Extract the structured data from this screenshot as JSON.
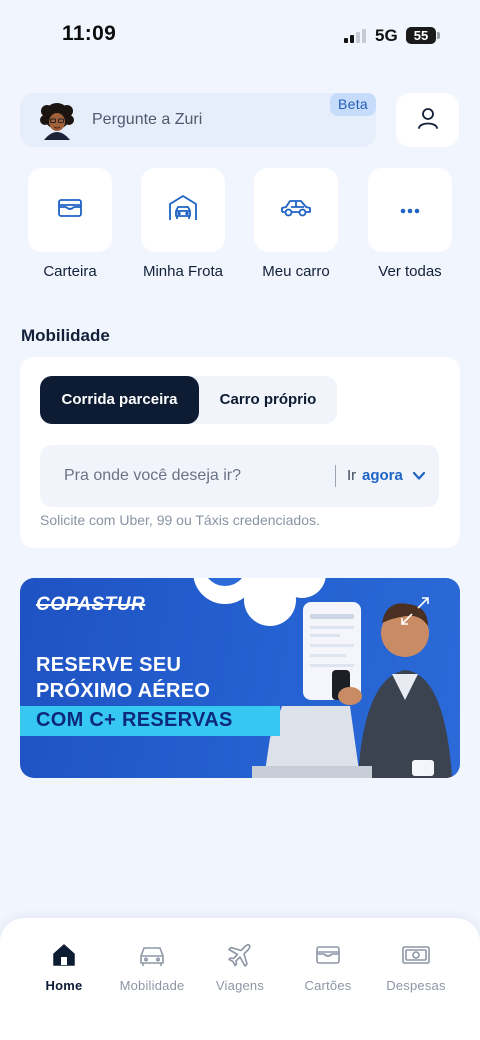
{
  "status_bar": {
    "time": "11:09",
    "network": "5G",
    "battery": "55"
  },
  "assistant": {
    "placeholder": "Pergunte a Zuri",
    "badge": "Beta",
    "avatar_icon": "zuri-avatar-icon"
  },
  "profile": {
    "icon": "user-icon"
  },
  "shortcuts": [
    {
      "label": "Carteira",
      "icon": "wallet-icon"
    },
    {
      "label": "Minha Frota",
      "icon": "garage-icon"
    },
    {
      "label": "Meu carro",
      "icon": "car-icon"
    },
    {
      "label": "Ver todas",
      "icon": "more-icon"
    }
  ],
  "mobility": {
    "title": "Mobilidade",
    "tabs": [
      {
        "label": "Corrida parceira",
        "active": true
      },
      {
        "label": "Carro próprio",
        "active": false
      }
    ],
    "destination_placeholder": "Pra onde você deseja ir?",
    "go_label": "Ir",
    "go_value": "agora",
    "helper": "Solicite com Uber, 99 ou Táxis credenciados."
  },
  "banner": {
    "brand": "COPASTUR",
    "line1": "RESERVE SEU",
    "line2": "PRÓXIMO AÉREO",
    "line3": "COM C+ RESERVAS"
  },
  "nav": [
    {
      "label": "Home",
      "icon": "home-icon",
      "active": true
    },
    {
      "label": "Mobilidade",
      "icon": "car-icon",
      "active": false
    },
    {
      "label": "Viagens",
      "icon": "airplane-icon",
      "active": false
    },
    {
      "label": "Cartões",
      "icon": "card-icon",
      "active": false
    },
    {
      "label": "Despesas",
      "icon": "cash-icon",
      "active": false
    }
  ],
  "colors": {
    "accent": "#1f63c4",
    "dark": "#0d1b33",
    "background": "#f1f5fd"
  }
}
